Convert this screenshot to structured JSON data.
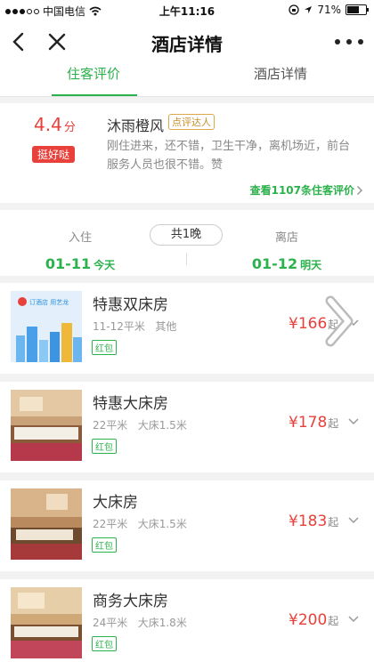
{
  "status_bar": {
    "carrier": "中国电信",
    "time": "上午11:16",
    "battery": "71%",
    "battery_level": 0.71
  },
  "nav": {
    "title": "酒店详情",
    "back_icon": "back-icon",
    "close_icon": "close-icon",
    "more_icon": "more-icon"
  },
  "tabs": [
    {
      "label": "住客评价",
      "active": true
    },
    {
      "label": "酒店详情",
      "active": false
    }
  ],
  "review": {
    "score": "4.4",
    "score_unit": "分",
    "score_label": "挺好哒",
    "reviewer": "沐雨橙风",
    "reviewer_badge": "点评达人",
    "text": "刚住进来，还不错，卫生干净，离机场近，前台服务人员也很不错。赞",
    "more_link": "查看1107条住客评价"
  },
  "stay": {
    "checkin_label": "入住",
    "checkin_date": "01-11",
    "checkin_day": "今天",
    "nights": "共1晚",
    "checkout_label": "离店",
    "checkout_date": "01-12",
    "checkout_day": "明天"
  },
  "rooms": [
    {
      "name": "特惠双床房",
      "area": "11-12平米",
      "bed": "其他",
      "tag": "红包",
      "price": "¥166",
      "price_suffix": "起",
      "thumb_text": "订酒店 用艺龙"
    },
    {
      "name": "特惠大床房",
      "area": "22平米",
      "bed": "大床1.5米",
      "tag": "红包",
      "price": "¥178",
      "price_suffix": "起"
    },
    {
      "name": "大床房",
      "area": "22平米",
      "bed": "大床1.5米",
      "tag": "红包",
      "price": "¥183",
      "price_suffix": "起"
    },
    {
      "name": "商务大床房",
      "area": "24平米",
      "bed": "大床1.8米",
      "tag": "红包",
      "price": "¥200",
      "price_suffix": "起"
    }
  ],
  "colors": {
    "accent_green": "#2bb24c",
    "price_red": "#e8403a"
  }
}
